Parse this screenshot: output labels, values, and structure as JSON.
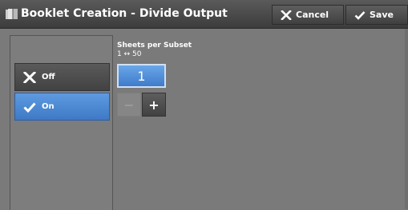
{
  "header": {
    "title": "Booklet Creation - Divide Output",
    "cancel_label": "Cancel",
    "save_label": "Save"
  },
  "options": {
    "off_label": "Off",
    "on_label": "On",
    "selected": "On"
  },
  "sheets_per_subset": {
    "label": "Sheets per Subset",
    "range": "1 ↔ 50",
    "value": "1",
    "minus_label": "−",
    "plus_label": "+"
  },
  "icons": {
    "title": "booklet-icon",
    "cancel": "x-icon",
    "save": "checkmark-icon",
    "off": "x-icon",
    "on": "checkmark-icon"
  },
  "colors": {
    "selected_blue": "#4a87d3",
    "background_gray": "#7a7a7a",
    "button_dark": "#4a4a4a"
  }
}
